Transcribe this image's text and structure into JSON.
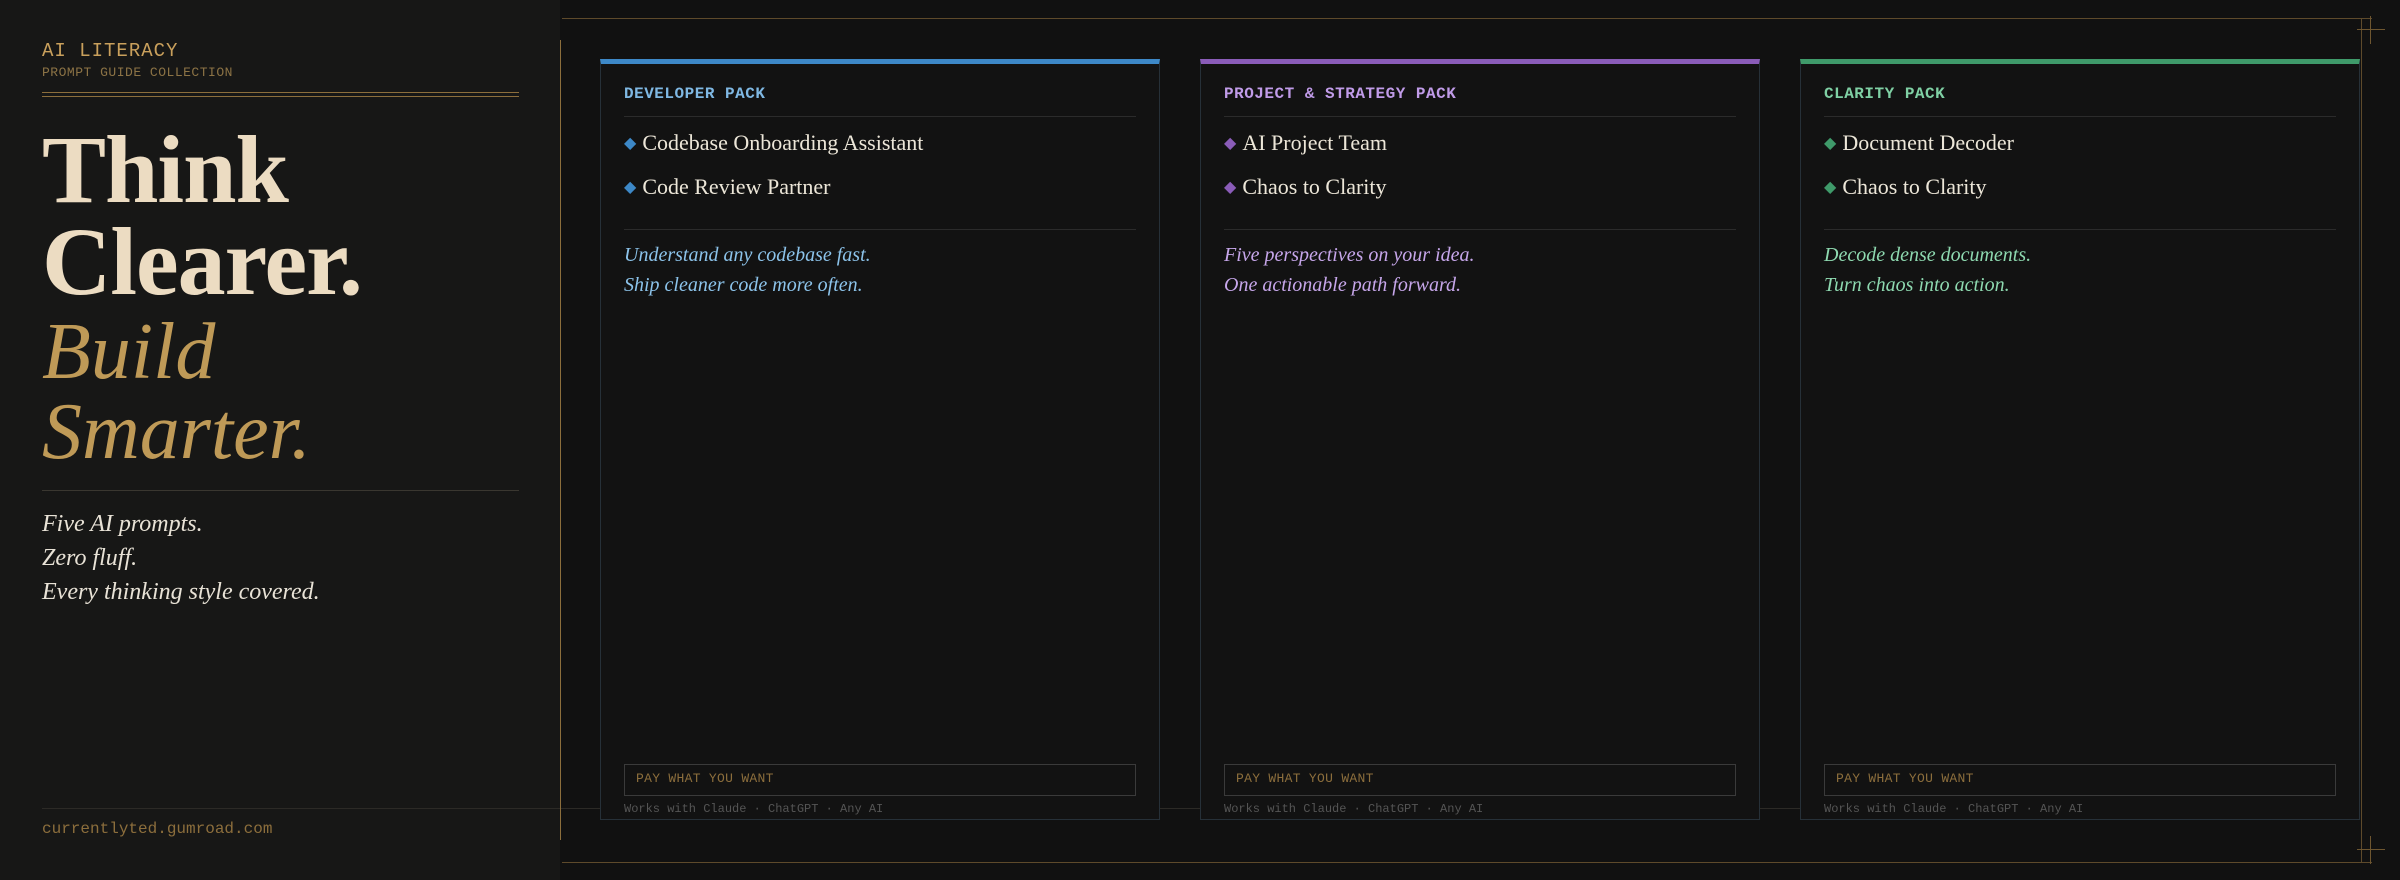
{
  "brand": {
    "title": "AI LITERACY",
    "subtitle": "PROMPT GUIDE COLLECTION"
  },
  "hero": {
    "line1": "Think",
    "line2": "Clearer.",
    "line3": "Build",
    "line4": "Smarter."
  },
  "tagline": [
    "Five AI prompts.",
    "Zero fluff.",
    "Every thinking style covered."
  ],
  "footer_url": "currentlyted.gumroad.com",
  "cards": [
    {
      "title": "DEVELOPER PACK",
      "accent": "#3d88c7",
      "title_color": "#7fb8e3",
      "items": [
        "Codebase Onboarding Assistant",
        "Code Review Partner"
      ],
      "desc": [
        "Understand any codebase fast.",
        "Ship cleaner code more often."
      ],
      "desc_color": "#8cc3ea",
      "cta": "PAY WHAT YOU WANT",
      "works": "Works with Claude · ChatGPT · Any AI"
    },
    {
      "title": "PROJECT & STRATEGY PACK",
      "accent": "#8a5cb8",
      "title_color": "#c09be8",
      "items": [
        "AI Project Team",
        "Chaos to Clarity"
      ],
      "desc": [
        "Five perspectives on your idea.",
        "One actionable path forward."
      ],
      "desc_color": "#c6a6ea",
      "cta": "PAY WHAT YOU WANT",
      "works": "Works with Claude · ChatGPT · Any AI"
    },
    {
      "title": "CLARITY PACK",
      "accent": "#3f9a6a",
      "title_color": "#7fd0a4",
      "items": [
        "Document Decoder",
        "Chaos to Clarity"
      ],
      "desc": [
        "Decode dense documents.",
        "Turn chaos into action."
      ],
      "desc_color": "#8ed9b0",
      "cta": "PAY WHAT YOU WANT",
      "works": "Works with Claude · ChatGPT · Any AI"
    }
  ],
  "icons": {
    "bullet": "diamond-icon",
    "corner": "crosshair-icon"
  }
}
